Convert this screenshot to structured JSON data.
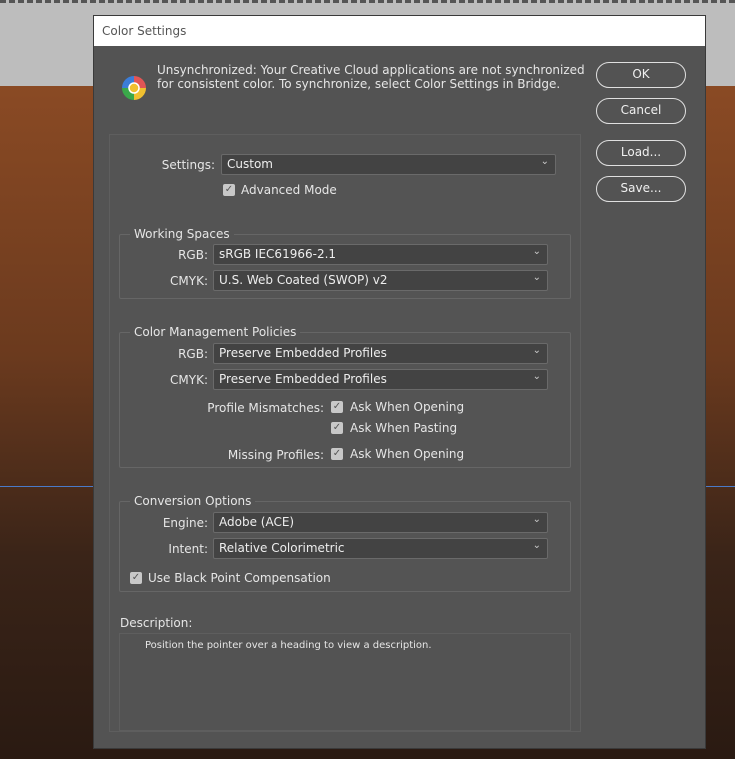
{
  "dialog": {
    "title": "Color Settings",
    "message": "Unsynchronized: Your Creative Cloud applications are not synchronized for consistent color. To synchronize, select Color Settings in Bridge."
  },
  "buttons": {
    "ok": "OK",
    "cancel": "Cancel",
    "load": "Load...",
    "save": "Save..."
  },
  "settings": {
    "label": "Settings:",
    "value": "Custom",
    "advanced_mode": "Advanced Mode"
  },
  "working_spaces": {
    "title": "Working Spaces",
    "rgb_label": "RGB:",
    "rgb_value": "sRGB IEC61966-2.1",
    "cmyk_label": "CMYK:",
    "cmyk_value": "U.S. Web Coated (SWOP) v2"
  },
  "policies": {
    "title": "Color Management Policies",
    "rgb_label": "RGB:",
    "rgb_value": "Preserve Embedded Profiles",
    "cmyk_label": "CMYK:",
    "cmyk_value": "Preserve Embedded Profiles",
    "mismatch_label": "Profile Mismatches:",
    "ask_opening": "Ask When Opening",
    "ask_pasting": "Ask When Pasting",
    "missing_label": "Missing Profiles:",
    "missing_ask_opening": "Ask When Opening"
  },
  "conversion": {
    "title": "Conversion Options",
    "engine_label": "Engine:",
    "engine_value": "Adobe (ACE)",
    "intent_label": "Intent:",
    "intent_value": "Relative Colorimetric",
    "bpc": "Use Black Point Compensation"
  },
  "description": {
    "label": "Description:",
    "text": "Position the pointer over a heading to view a description."
  }
}
